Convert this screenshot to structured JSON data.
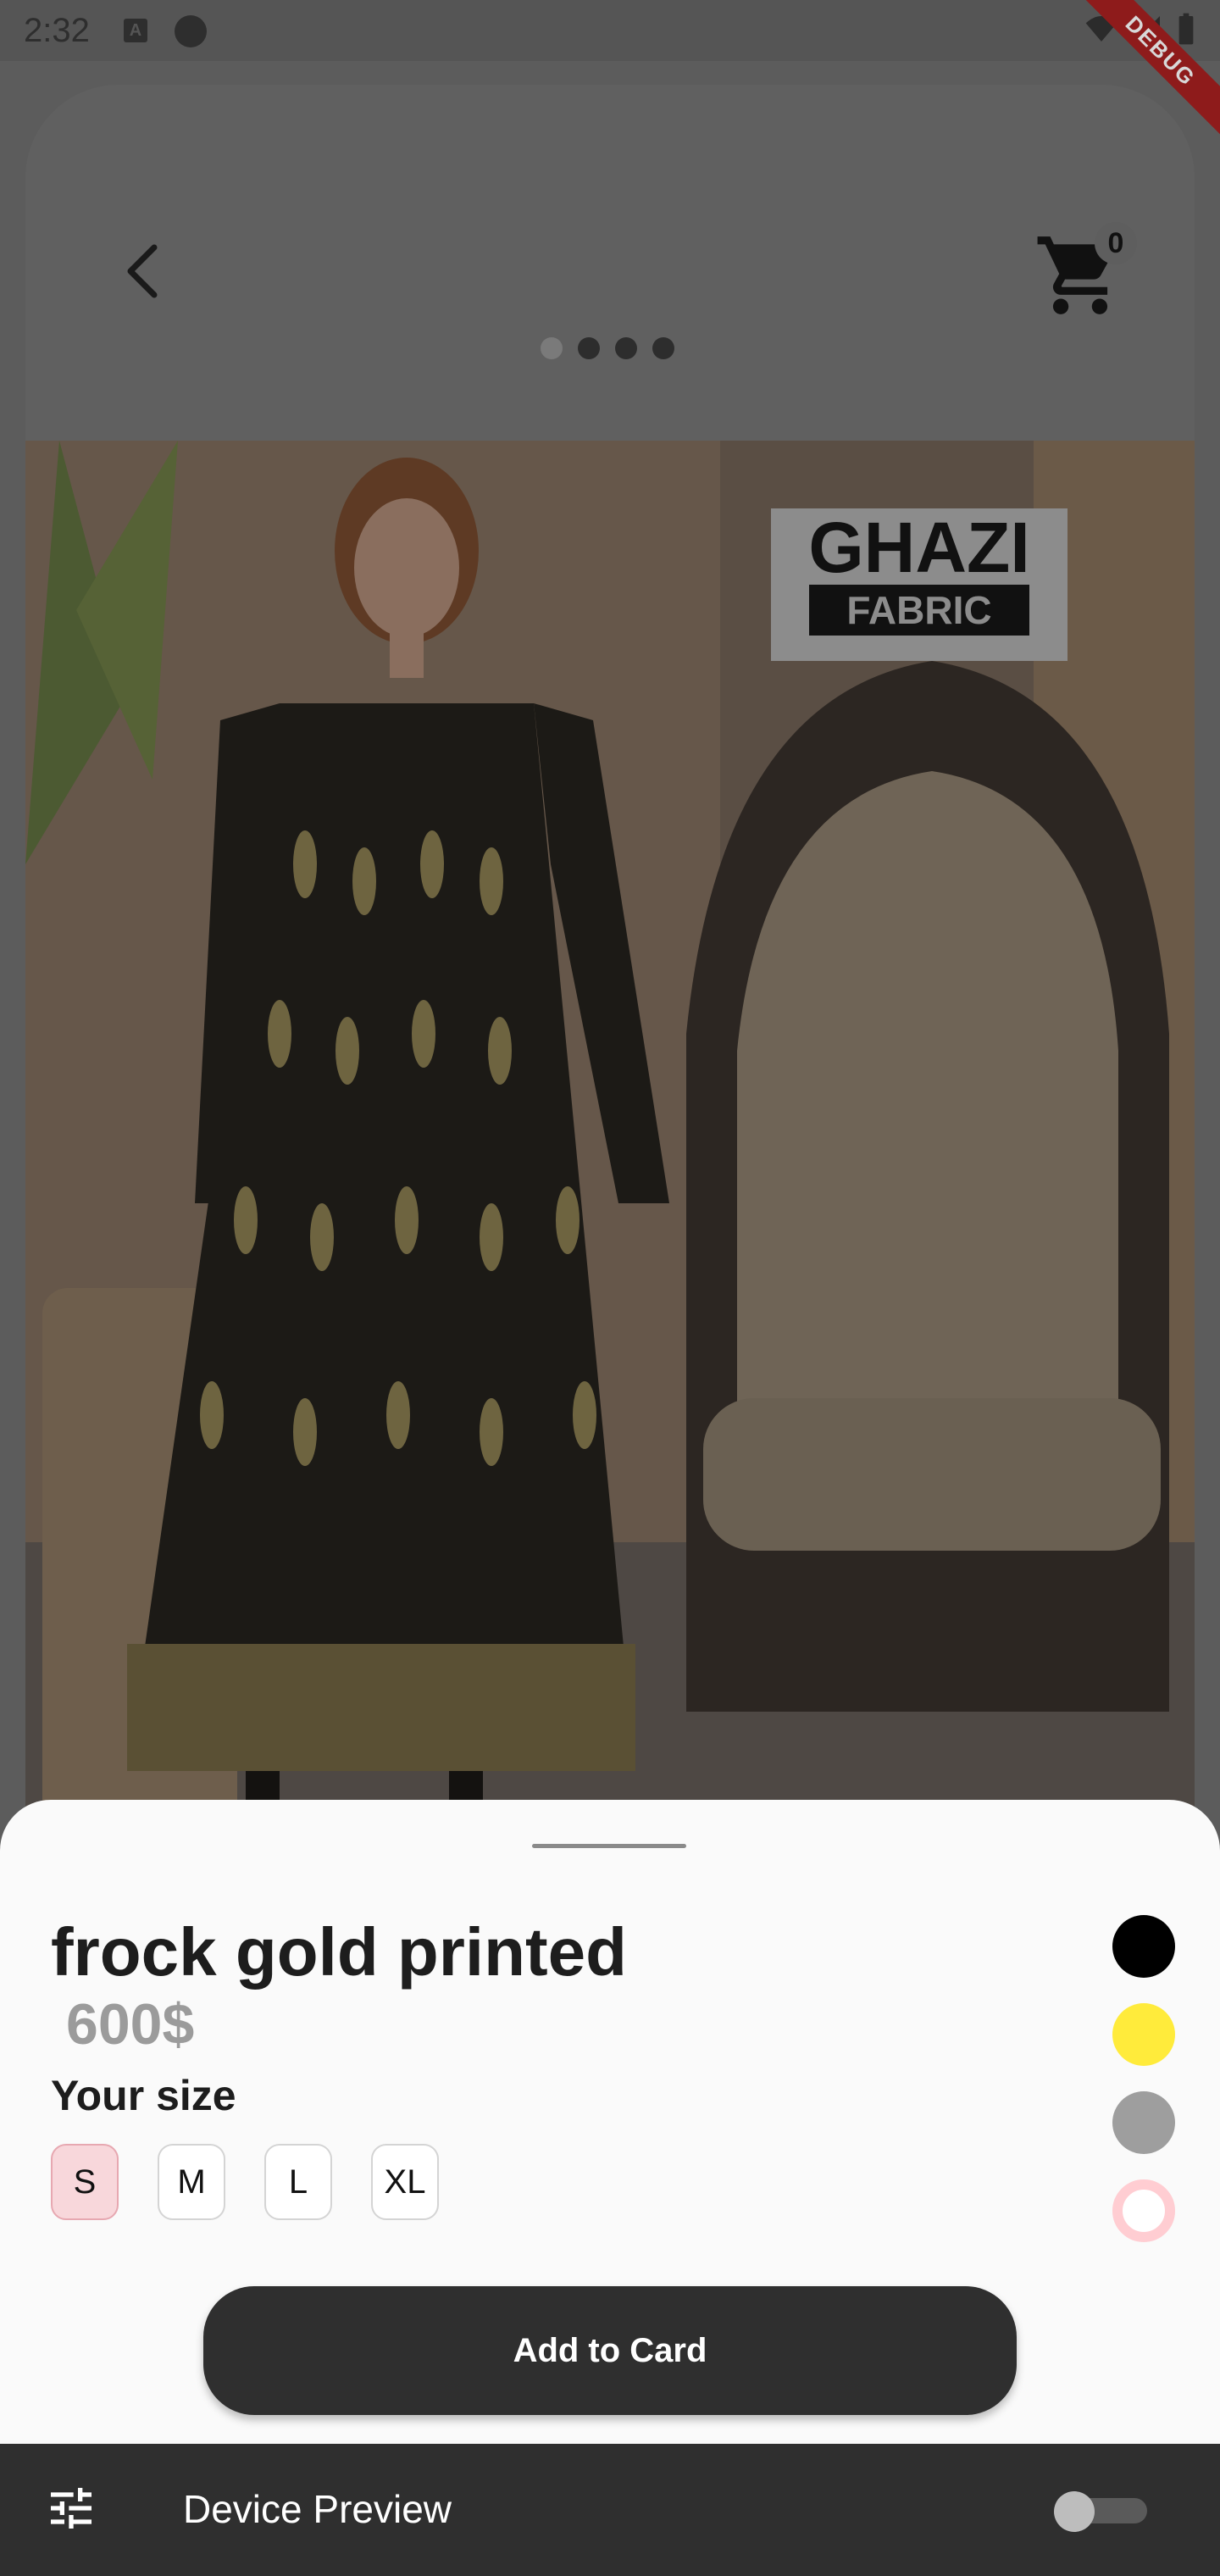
{
  "status_bar": {
    "time": "2:32",
    "a_icon": "A"
  },
  "debug_banner": {
    "label": "DEBUG"
  },
  "header": {
    "cart_count": "0",
    "image_pages": 4,
    "active_page": 0
  },
  "product": {
    "image_brand_text": "GHAZI",
    "image_brand_subtext": "FABRIC",
    "title": "frock gold printed",
    "price": "600$",
    "size_heading": "Your size",
    "sizes": [
      "S",
      "M",
      "L",
      "XL"
    ],
    "selected_size": "S",
    "colors": [
      "#000000",
      "#ffeb3b",
      "#9e9e9e",
      "#ffcdd2"
    ],
    "add_button_label": "Add to Card"
  },
  "device_preview": {
    "label": "Device Preview",
    "enabled": false
  }
}
